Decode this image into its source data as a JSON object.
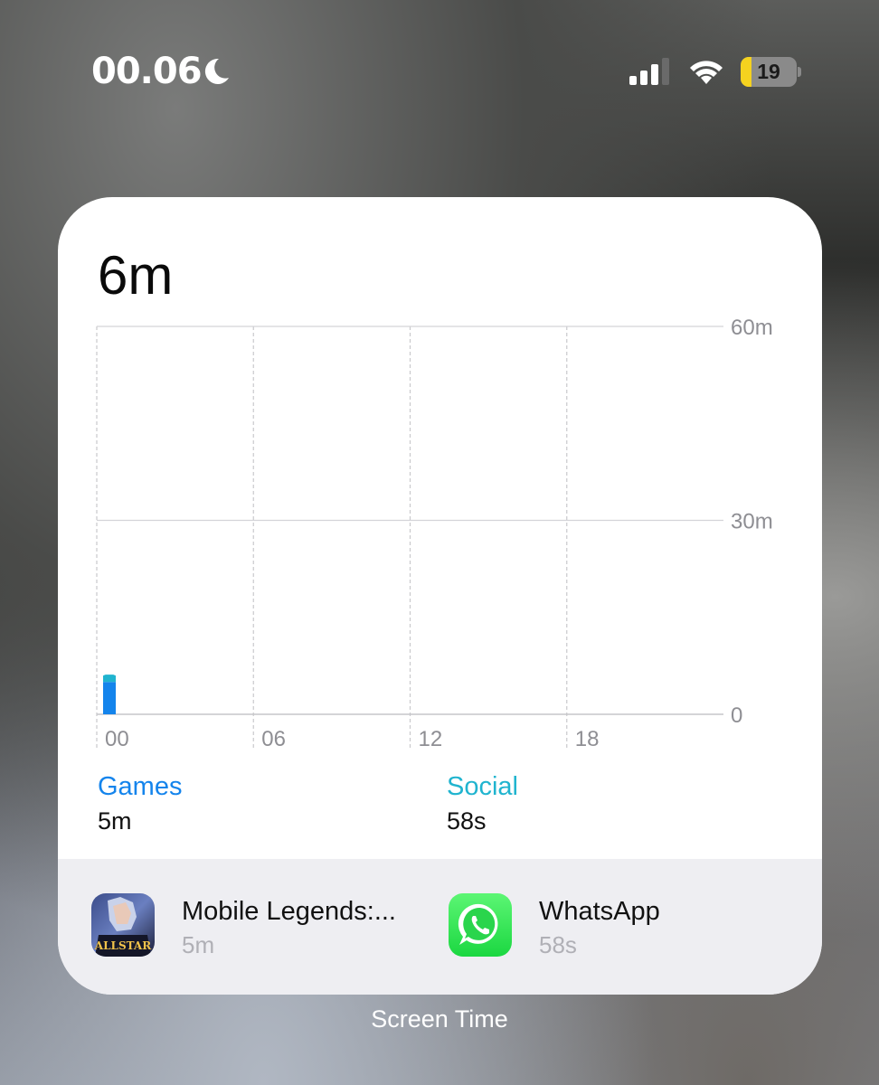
{
  "status_bar": {
    "time": "00.06",
    "battery_level": "19",
    "battery_fraction": 0.19,
    "signal_bars_filled": 3,
    "signal_bars_total": 4,
    "icons": [
      "moon-icon",
      "cellular-signal-icon",
      "wifi-icon",
      "battery-icon"
    ]
  },
  "widget": {
    "total": "6m",
    "name": "Screen Time"
  },
  "chart_data": {
    "type": "bar",
    "x_tick_labels": [
      "00",
      "06",
      "12",
      "18"
    ],
    "y_tick_labels": [
      "60m",
      "30m",
      "0"
    ],
    "ylim": [
      0,
      60
    ],
    "hours": 24,
    "bars": [
      {
        "hour": 0,
        "minutes": 6,
        "segments": [
          {
            "category": "Games",
            "minutes": 5
          },
          {
            "category": "Social",
            "minutes": 1
          }
        ]
      }
    ],
    "grid": true
  },
  "categories": [
    {
      "label": "Games",
      "value": "5m",
      "color": "#1484ec"
    },
    {
      "label": "Social",
      "value": "58s",
      "color": "#20b4cf"
    }
  ],
  "apps": [
    {
      "name": "Mobile Legends:...",
      "time": "5m",
      "icon": "mobile-legends-app-icon",
      "icon_text": "ALLSTAR"
    },
    {
      "name": "WhatsApp",
      "time": "58s",
      "icon": "whatsapp-app-icon"
    }
  ]
}
